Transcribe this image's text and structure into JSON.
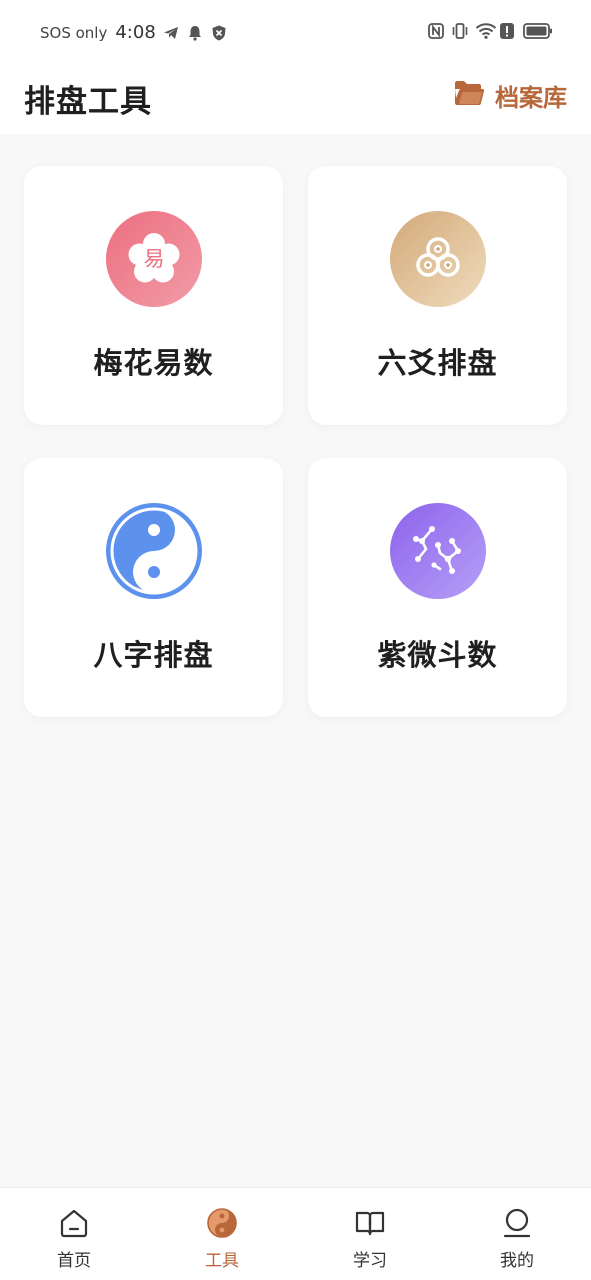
{
  "status_bar": {
    "carrier": "SOS only",
    "time": "4:08",
    "icons_left": [
      "telegram-icon",
      "bell-icon",
      "shield-icon"
    ],
    "icons_right": [
      "nfc-icon",
      "vibrate-icon",
      "wifi-icon",
      "alert-icon",
      "battery-icon"
    ]
  },
  "header": {
    "title": "排盘工具",
    "archive_label": "档案库",
    "archive_icon": "folder-open-icon"
  },
  "tools": [
    {
      "label": "梅花易数",
      "icon": "plum-blossom-icon",
      "glyph": "易",
      "colors": [
        "#ec6f7f",
        "#f19aa5"
      ]
    },
    {
      "label": "六爻排盘",
      "icon": "coins-icon",
      "colors": [
        "#d7b07b",
        "#ecd4b0"
      ]
    },
    {
      "label": "八字排盘",
      "icon": "yin-yang-icon",
      "colors": [
        "#5c92ee",
        "#7aa8f5"
      ]
    },
    {
      "label": "紫微斗数",
      "icon": "constellation-icon",
      "colors": [
        "#8c62ec",
        "#b39af7"
      ]
    }
  ],
  "bottom_nav": {
    "active": "工具",
    "items": [
      {
        "label": "首页",
        "icon": "home-icon"
      },
      {
        "label": "工具",
        "icon": "taiji-icon"
      },
      {
        "label": "学习",
        "icon": "book-icon"
      },
      {
        "label": "我的",
        "icon": "user-icon"
      }
    ]
  },
  "colors": {
    "accent": "#b8673a",
    "background": "#f8f8f8",
    "card": "#ffffff",
    "text": "#1f1f1f"
  }
}
